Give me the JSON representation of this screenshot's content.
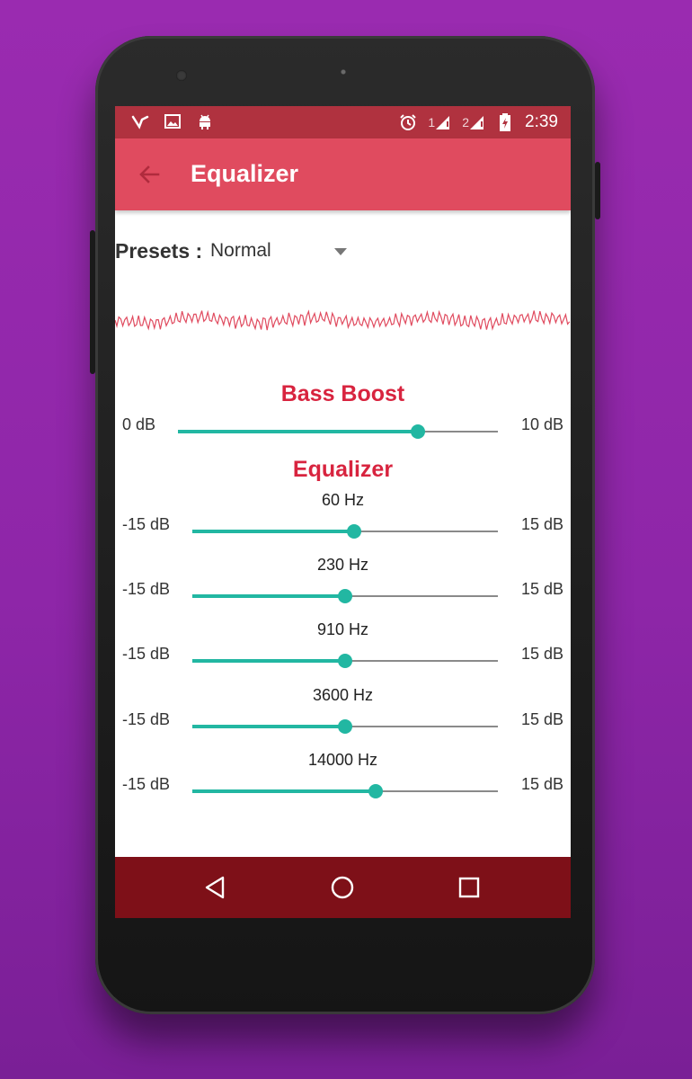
{
  "status_bar": {
    "left_icons": [
      "v-app-icon",
      "image-icon",
      "android-icon"
    ],
    "right_icons": [
      "alarm-icon",
      "sim1-signal-icon",
      "sim2-signal-icon",
      "battery-charging-icon"
    ],
    "sim1_label": "1",
    "sim2_label": "2",
    "time": "2:39"
  },
  "app_bar": {
    "title": "Equalizer",
    "back_icon": "arrow-back-icon"
  },
  "presets": {
    "label": "Presets :",
    "selected": "Normal"
  },
  "bass_boost": {
    "title": "Bass Boost",
    "min_label": "0 dB",
    "max_label": "10 dB",
    "value_fraction": 0.75
  },
  "equalizer": {
    "title": "Equalizer",
    "bands": [
      {
        "freq": "60 Hz",
        "min_label": "-15 dB",
        "max_label": "15 dB",
        "value_fraction": 0.53
      },
      {
        "freq": "230 Hz",
        "min_label": "-15 dB",
        "max_label": "15 dB",
        "value_fraction": 0.5
      },
      {
        "freq": "910 Hz",
        "min_label": "-15 dB",
        "max_label": "15 dB",
        "value_fraction": 0.5
      },
      {
        "freq": "3600 Hz",
        "min_label": "-15 dB",
        "max_label": "15 dB",
        "value_fraction": 0.5
      },
      {
        "freq": "14000 Hz",
        "min_label": "-15 dB",
        "max_label": "15 dB",
        "value_fraction": 0.6
      }
    ]
  },
  "nav_bar": {
    "icons": [
      "back-triangle-icon",
      "home-circle-icon",
      "recents-square-icon"
    ]
  },
  "colors": {
    "status_bar": "#b0323f",
    "app_bar": "#e04b5f",
    "accent": "#22b7a2",
    "section_title": "#d8243f",
    "nav_bar": "#7e1018",
    "background": "#9a2bb0"
  }
}
